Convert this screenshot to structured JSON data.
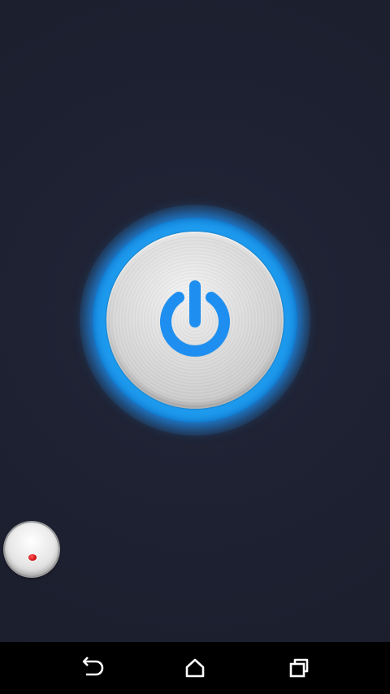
{
  "app": {
    "accent_color": "#1e9cf0",
    "background_color": "#1d2030"
  },
  "power_button": {
    "icon": "power-icon",
    "state": "on"
  },
  "small_knob": {
    "icon": "red-dot-indicator",
    "dot_color": "#d41515"
  },
  "navigation_bar": {
    "buttons": [
      {
        "icon": "back-icon"
      },
      {
        "icon": "home-icon"
      },
      {
        "icon": "recent-apps-icon"
      }
    ]
  }
}
